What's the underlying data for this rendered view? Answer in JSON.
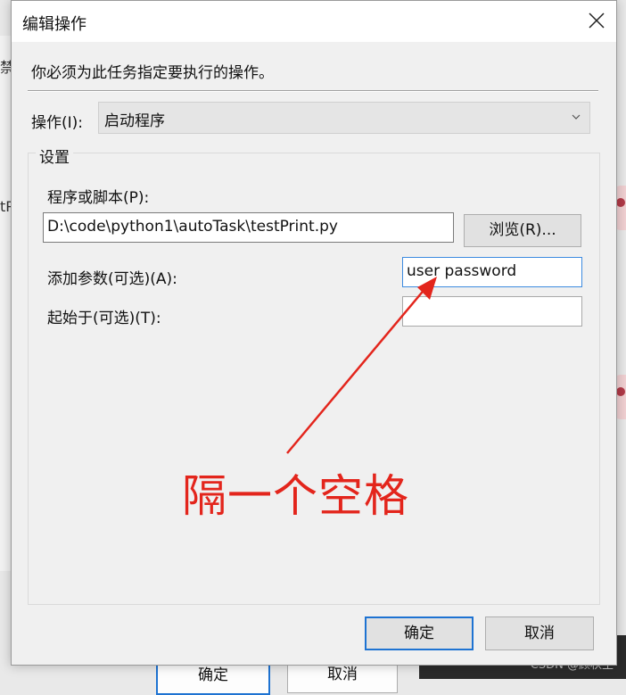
{
  "dialog": {
    "title": "编辑操作",
    "instruction": "你必须为此任务指定要执行的操作。",
    "action_label": "操作(I):",
    "action_value": "启动程序",
    "settings_group_title": "设置",
    "program_label": "程序或脚本(P):",
    "program_value": "D:\\code\\python1\\autoTask\\testPrint.py",
    "browse_button": "浏览(R)...",
    "args_label": "添加参数(可选)(A):",
    "args_value": "user password",
    "start_in_label": "起始于(可选)(T):",
    "start_in_value": "",
    "ok_button": "确定",
    "cancel_button": "取消"
  },
  "annotation": {
    "text": "隔一个空格",
    "color": "#e3251c"
  },
  "background": {
    "left_fragment_1": "禁",
    "left_fragment_2": "tP",
    "under_ok": "确定",
    "under_cancel": "取消"
  },
  "watermark": "CSDN @顾秋生"
}
